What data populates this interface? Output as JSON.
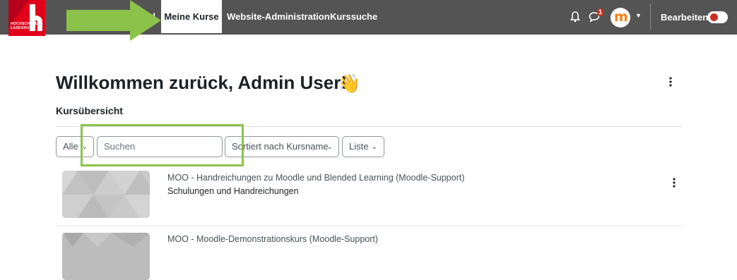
{
  "nav": {
    "home_fragment": "d",
    "my_courses": "Meine Kurse",
    "site_admin": "Website-Administration",
    "course_search": "Kurssuche",
    "message_count": "1",
    "edit_mode": "Bearbeiten",
    "logo_text_1": "HOCHSCHULE",
    "logo_text_2": "LANDSHUT"
  },
  "colors": {
    "navbar": "#545454",
    "logo": "#e2001a",
    "highlight": "#8bc34a",
    "toggle_knob": "#ca3120"
  },
  "icons": [
    "bell-icon",
    "chat-icon",
    "chevron-down-icon",
    "kebab-icon",
    "wave-icon"
  ],
  "page": {
    "title": "Willkommen zurück, Admin User!",
    "emoji": "👋"
  },
  "overview": {
    "title": "Kursübersicht",
    "filter": "Alle",
    "search_placeholder": "Suchen",
    "sort": "Sortiert nach Kursname",
    "view": "Liste"
  },
  "courses": [
    {
      "name": "MOO - Handreichungen zu Moodle und Blended Learning (Moodle-Support)",
      "category": "Schulungen und Handreichungen"
    },
    {
      "name": "MOO - Moodle-Demonstrationskurs (Moodle-Support)",
      "category": ""
    }
  ]
}
